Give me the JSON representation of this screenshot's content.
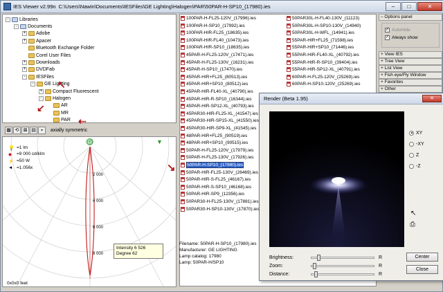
{
  "window": {
    "title": "IES Viewer v2.99n",
    "path": "C:\\Users\\Nawin\\Documents\\IESFiles\\GE Lighting\\Halogen\\PAR\\50PAR-H-SP10_(17980).ies",
    "min_label": "–",
    "max_label": "□",
    "close_label": "✕"
  },
  "tree": [
    {
      "label": "Libraries",
      "level": 0,
      "exp": "-",
      "kind": "lib"
    },
    {
      "label": "Documents",
      "level": 1,
      "exp": "-",
      "kind": "lib"
    },
    {
      "label": "Adobe",
      "level": 2,
      "exp": "+",
      "kind": "folder"
    },
    {
      "label": "Apacer",
      "level": 2,
      "exp": "+",
      "kind": "folder"
    },
    {
      "label": "Bluetooth Exchange Folder",
      "level": 2,
      "exp": "",
      "kind": "folder"
    },
    {
      "label": "Corel User Files",
      "level": 2,
      "exp": "",
      "kind": "folder"
    },
    {
      "label": "Downloads",
      "level": 2,
      "exp": "+",
      "kind": "folder"
    },
    {
      "label": "DVDFab",
      "level": 2,
      "exp": "+",
      "kind": "folder"
    },
    {
      "label": "IESFiles",
      "level": 2,
      "exp": "-",
      "kind": "folder"
    },
    {
      "label": "GE Lighting",
      "level": 3,
      "exp": "-",
      "kind": "folder"
    },
    {
      "label": "Compact Fluorescent",
      "level": 4,
      "exp": "+",
      "kind": "folder"
    },
    {
      "label": "Halogen",
      "level": 4,
      "exp": "-",
      "kind": "folder"
    },
    {
      "label": "AR",
      "level": 5,
      "exp": "",
      "kind": "folder"
    },
    {
      "label": "MR",
      "level": 5,
      "exp": "",
      "kind": "folder"
    },
    {
      "label": "PAR",
      "level": 5,
      "exp": "",
      "kind": "folder"
    }
  ],
  "toolbar": {
    "mode_label": "axially symmetric"
  },
  "polar": {
    "lumens": "=1 lm",
    "cd": "=9 000 cd/klm",
    "watts": "=50 W",
    "ratio": "=1.056x",
    "units": "0x0x0 feet",
    "rings": [
      "2 000",
      "4 000",
      "6 000",
      "8 000"
    ],
    "tooltip_intensity": "Intensity 6 526",
    "tooltip_degree": "Degree 62"
  },
  "files_col1": [
    "100PAR-H-FL25-120V_(17996).ies",
    "100PAR-H-SP10_(17992).ies",
    "100PAR-HIR-FL25_(18635).ies",
    "100PAR-HIR-FL40_(10473).ies",
    "100PAR-HIR-SP10_(18635).ies",
    "45PAR-H-FL25-120V_(17471).ies",
    "45PAR-H-FL25-130V_(16231).ies",
    "45PAR-H-SP10_(17470).ies",
    "45PAR-HIR+FL25_(80513).ies",
    "45PAR-HIR+SP10_(80512).ies",
    "45PAR-HIR-FL40-XL_(40790).ies",
    "45PAR-HIR-R-SP10_(16344).ies",
    "45PAR-HIR-SP12-XL_(40793).ies",
    "45PAR30-HIR-FL25-XL_(41547).ies",
    "45PAR30-HIR-SP15-XL_(41550).ies",
    "45PAR30-HIR-SP9-XL_(41545).ies",
    "48PAR-HIR+FL25_(90519).ies",
    "48PAR-HIR+SP10_(90515).ies",
    "50PAR-H-FL25-120V_(17979).ies",
    "50PAR-H-FL25-130V_(17926).ies",
    "50PAR-H-SP10_(17980).ies",
    "50PAR-HIR-FL25-130V_(26469).ies",
    "50PAR-HIR-S-FL25_(46167).ies",
    "50PAR-HIR-S-SP10_(46168).ies",
    "50PAR-HIR-SP9_(12356).ies",
    "50PAR30-H-FL25-130V_(17881).ies",
    "50PAR30-H-SP10-130V_(17870).ies"
  ],
  "selected_file": "50PAR-H-SP10_(17980).ies",
  "files_col2": [
    "50PAR30L-H-FL40-130V_(11123)",
    "50PAR30L-H-SP10-130V_(14940)",
    "50PAR30L-H-WFL_(14941).ies",
    "55PAR-HIR+FL25_(71598).ies",
    "55PAR-HIR+SP10_(71446).ies",
    "55PAR-HIR-FL40-XL_(40792).ies",
    "55PAR-HIR-R-SP10_(39404).ies",
    "55PAR-HIR-SP12-XL_(40791).ies",
    "60PAR-H-FL25-120V_(25269).ies",
    "60PAR-H-SP10-120V_(25269).ies"
  ],
  "file_info": {
    "filename": "Filename: 50PAR-H-SP10_(17980).ies",
    "manufacturer": "Manufacturer: GE LIGHTING",
    "catalog": "Lamp catalog: 17980",
    "lamp": "Lamp: 50PAR-H/SP10"
  },
  "options_panel": {
    "title": "Options panel",
    "autohide": "AutoHide",
    "always_show": "Always show",
    "items": [
      "View IES",
      "Tree View",
      "List View",
      "Fish eye/Fly Window",
      "Favorites",
      "Other"
    ]
  },
  "render": {
    "title": "Render (Beta 1.95)",
    "close_label": "✕",
    "planes": [
      "XY",
      "-XY",
      "Z",
      "-Z"
    ],
    "brightness_label": "Brightness:",
    "zoom_label": "Zoom:",
    "distance_label": "Distance:",
    "reset_letter": "R",
    "center_label": "Center",
    "close_button": "Close"
  }
}
